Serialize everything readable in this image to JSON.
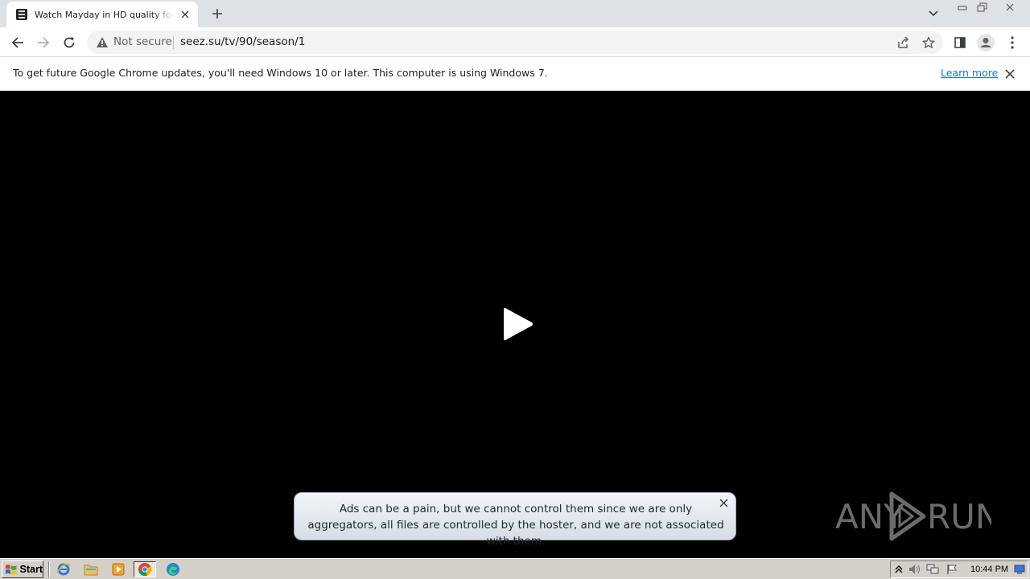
{
  "browser": {
    "tab": {
      "title": "Watch Mayday in HD quality for free",
      "favicon": "seez-favicon-icon"
    },
    "new_tab_icon": "plus-icon",
    "tab_list_icon": "chevron-down-icon",
    "window_controls": [
      "minimize-icon",
      "restore-icon",
      "close-icon"
    ],
    "toolbar": {
      "back_icon": "arrow-left-icon",
      "forward_icon": "arrow-right-icon",
      "reload_icon": "reload-icon",
      "security_icon": "warning-triangle-icon",
      "security_label": "Not secure",
      "url": "seez.su/tv/90/season/1",
      "share_icon": "share-icon",
      "bookmark_icon": "star-icon",
      "side_panel_icon": "side-panel-icon",
      "profile_icon": "profile-icon",
      "menu_icon": "kebab-menu-icon"
    },
    "infobar": {
      "message": "To get future Google Chrome updates, you'll need Windows 10 or later. This computer is using Windows 7.",
      "link": "Learn more",
      "close_icon": "close-icon"
    }
  },
  "page": {
    "background": "#000000",
    "play_icon": "play-icon",
    "notice": {
      "text": "Ads can be a pain, but we cannot control them since we are only aggregators, all files are controlled by the hoster, and we are not associated with them.",
      "close_icon": "close-icon"
    },
    "watermark": {
      "left_text": "ANY",
      "right_text": "RUN"
    }
  },
  "taskbar": {
    "start_label": "Start",
    "quick_launch": [
      "internet-explorer-icon",
      "folder-icon",
      "media-player-icon",
      "chrome-icon",
      "edge-icon"
    ],
    "active_item": "chrome-icon",
    "tray": [
      "show-hidden-icon",
      "volume-icon",
      "network-icon",
      "flag-icon"
    ],
    "clock": "10:44 PM",
    "show_desktop_icon": "show-desktop-icon"
  },
  "colors": {
    "tabstrip": "#dee1e6",
    "link": "#1a73e8",
    "taskbar": "#d4d0c8"
  }
}
